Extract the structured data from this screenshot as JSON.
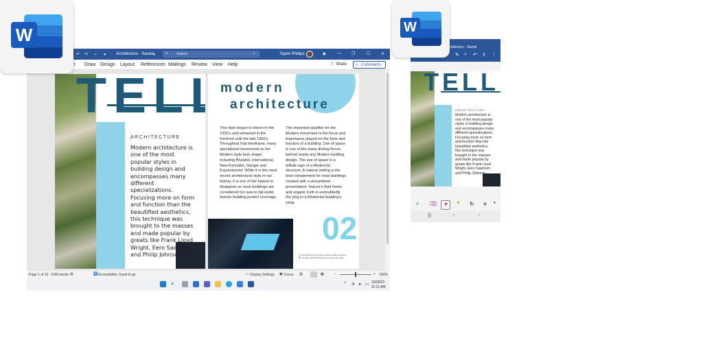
{
  "app": {
    "name": "Word",
    "logo_letter": "W"
  },
  "titlebar": {
    "doc_title": "Architecture - Saved",
    "search_placeholder": "Search",
    "user_name": "Taylor Phillips"
  },
  "ribbon": {
    "tabs": [
      "rt",
      "Draw",
      "Design",
      "Layout",
      "References",
      "Mailings",
      "Review",
      "View",
      "Help"
    ],
    "share_label": "Share",
    "comments_label": "Comments"
  },
  "document": {
    "big_title": "TELL",
    "heading_line1": "modern",
    "heading_line2": "architecture",
    "section_label": "ARCHITECTURE",
    "intro_text": "Modern architecture is one of the most popular styles in building design and encompasses many different specializations. Focusing more on form and function than the beautified aesthetics, this technique was brought to the masses and made popular by greats like Frank Lloyd Wright, Eero Saarinen and Philip Johnson.",
    "col1_text": "This style began to bloom in the 1930's and remained in the forefront until the late 1960's. Throughout that timeframe, many specialized movements to the Modern style took shape, including Brutalist, International, New Formalist, Googie and Expressionist. While it is the most recent architectural style in our history, it is one of the fastest to disappear as most buildings are considered too new to fall under historic building protect coverage.",
    "col2_text": "The important qualifier for the Modern movement is the focus and importance placed on the form and function of a building. Use of space is one of the many driving forces behind nearly any Modern building design. The use of space is a telltale sign of a Modernist structure. A natural setting is the best complement for most buildings created with a streamlined presentation. Nature's fluid forms and organic truth is undoubtedly the ying to a Modernist building's yang.",
    "page_number": "02",
    "caption": "This angled form of a tower or space provides contrast to the planet mechanized linearity of an optimized space."
  },
  "statusbar": {
    "page_info": "Page 1 of 10",
    "word_count": "2190 words",
    "accessibility": "Accessibility: Good to go",
    "display_settings": "Display Settings",
    "focus": "Focus",
    "zoom": "100%",
    "zoom_level": 1.0
  },
  "taskbar": {
    "date": "10/20/21",
    "time": "11:11 AM"
  },
  "phone": {
    "doc_title": "Architecture - Saved",
    "big_title": "TELL",
    "section_label": "ARCHITECTURE",
    "intro_text": "Modern architecture is one of the most popular styles in building design and encompasses many different specializations. Focusing more on form and function than the beautified aesthetics, this technique was brought to the masses and made popular by greats like Frank Lloyd Wright, Eero Saarinen and Philip Johnson."
  },
  "colors": {
    "word_blue": "#2b579a",
    "doc_teal": "#1e5a78",
    "light_blue": "#8fd3e8",
    "accent_cyan": "#7fd4ec",
    "dark": "#1c2430"
  }
}
